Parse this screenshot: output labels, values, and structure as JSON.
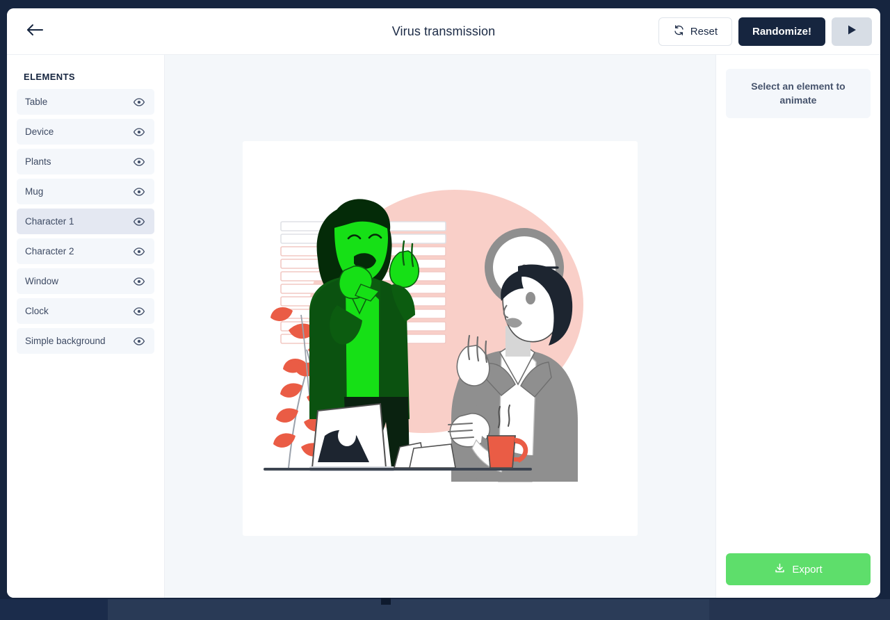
{
  "window": {
    "title": "Virus transmission"
  },
  "header": {
    "back_icon": "arrow-left-icon",
    "title": "Virus transmission",
    "reset_label": "Reset",
    "reset_icon": "refresh-icon",
    "randomize_label": "Randomize!",
    "play_icon": "play-icon"
  },
  "sidebar": {
    "heading": "ELEMENTS",
    "items": [
      {
        "label": "Table",
        "icon": "eye-icon",
        "selected": false
      },
      {
        "label": "Device",
        "icon": "eye-icon",
        "selected": false
      },
      {
        "label": "Plants",
        "icon": "eye-icon",
        "selected": false
      },
      {
        "label": "Mug",
        "icon": "eye-icon",
        "selected": false
      },
      {
        "label": "Character 1",
        "icon": "eye-icon",
        "selected": true
      },
      {
        "label": "Character 2",
        "icon": "eye-icon",
        "selected": false
      },
      {
        "label": "Window",
        "icon": "eye-icon",
        "selected": false
      },
      {
        "label": "Clock",
        "icon": "eye-icon",
        "selected": false
      },
      {
        "label": "Simple background",
        "icon": "eye-icon",
        "selected": false
      }
    ]
  },
  "right_panel": {
    "hint": "Select an element to animate",
    "export_label": "Export",
    "export_icon": "download-icon"
  },
  "canvas": {
    "illustration_name": "virus-transmission-illustration",
    "description": "Woman in green sneezing next to man in gray suit recoiling, office with blinds, clock, plant, laptop and mug"
  },
  "colors": {
    "window_chrome": "#16253f",
    "accent_dark": "#16253f",
    "export_green": "#5ede6b",
    "canvas_bg": "#f4f7fa",
    "item_bg": "#f4f7fb",
    "item_selected_bg": "#e4e8f2",
    "illustration_pink": "#f9cfc8",
    "illustration_green_bright": "#16e016",
    "illustration_green_dark": "#0c5c10",
    "illustration_green_darkest": "#042b08",
    "illustration_coral": "#ea5c45",
    "illustration_gray": "#8f8f8f",
    "illustration_ink": "#1d2530"
  }
}
